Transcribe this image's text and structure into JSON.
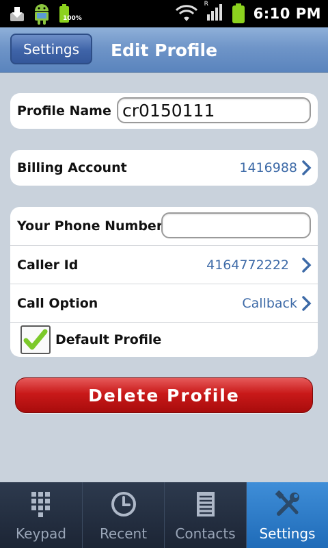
{
  "status_bar": {
    "time": "6:10 PM",
    "battery_label": "100%",
    "network_label": "R",
    "icons": [
      "download-icon",
      "android-icon",
      "battery-small-icon",
      "wifi-icon",
      "signal-icon",
      "battery-icon"
    ]
  },
  "header": {
    "back_label": "Settings",
    "title": "Edit Profile"
  },
  "profile": {
    "name_label": "Profile Name",
    "name_value": "cr0150111"
  },
  "billing": {
    "label": "Billing Account",
    "value": "1416988"
  },
  "phone": {
    "label": "Your Phone Number",
    "value": "",
    "caller_id_label": "Caller Id",
    "caller_id_value": "4164772222",
    "call_option_label": "Call Option",
    "call_option_value": "Callback",
    "default_label": "Default Profile",
    "default_checked": true
  },
  "delete_button": {
    "label": "Delete Profile"
  },
  "tabs": [
    {
      "label": "Keypad",
      "icon": "keypad-icon",
      "active": false
    },
    {
      "label": "Recent",
      "icon": "clock-icon",
      "active": false
    },
    {
      "label": "Contacts",
      "icon": "contacts-icon",
      "active": false
    },
    {
      "label": "Settings",
      "icon": "tools-icon",
      "active": true
    }
  ],
  "colors": {
    "header_blue": "#6f95c8",
    "link_blue": "#3d6aa7",
    "delete_red": "#c91919",
    "active_tab": "#2f7cc8"
  }
}
